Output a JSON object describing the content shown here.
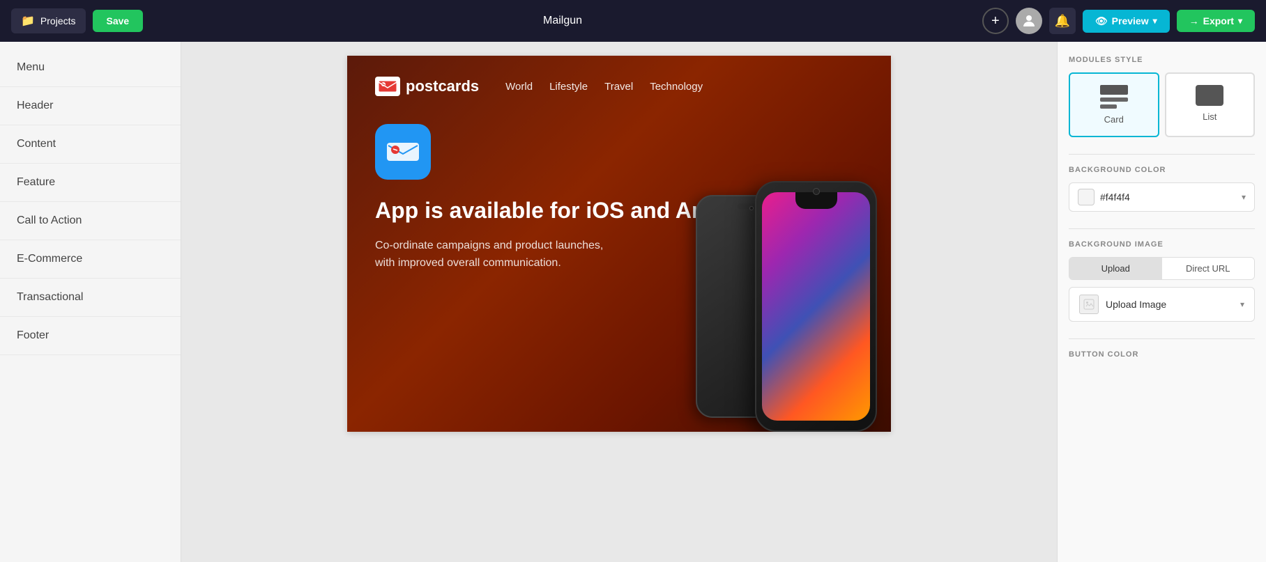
{
  "topbar": {
    "projects_label": "Projects",
    "save_label": "Save",
    "app_name": "Mailgun",
    "preview_label": "Preview",
    "export_label": "Export"
  },
  "left_sidebar": {
    "items": [
      {
        "id": "menu",
        "label": "Menu"
      },
      {
        "id": "header",
        "label": "Header"
      },
      {
        "id": "content",
        "label": "Content"
      },
      {
        "id": "feature",
        "label": "Feature"
      },
      {
        "id": "call-to-action",
        "label": "Call to Action"
      },
      {
        "id": "e-commerce",
        "label": "E-Commerce"
      },
      {
        "id": "transactional",
        "label": "Transactional"
      },
      {
        "id": "footer",
        "label": "Footer"
      }
    ]
  },
  "email_preview": {
    "nav": {
      "logo_text": "postcards",
      "links": [
        "World",
        "Lifestyle",
        "Travel",
        "Technology"
      ]
    },
    "hero": {
      "title": "App is available for iOS and Android.",
      "description": "Co-ordinate campaigns and product launches, with improved overall communication."
    }
  },
  "right_panel": {
    "modules_style_title": "MODULES STYLE",
    "card_label": "Card",
    "list_label": "List",
    "bg_color_title": "BACKGROUND COLOR",
    "bg_color_value": "#f4f4f4",
    "bg_image_title": "BACKGROUND IMAGE",
    "upload_tab_label": "Upload",
    "direct_url_tab_label": "Direct URL",
    "upload_image_label": "Upload Image",
    "btn_color_title": "BUTTON COLOR"
  },
  "icons": {
    "folder": "📁",
    "plus": "+",
    "bell": "🔔",
    "eye": "👁",
    "arrow_right": "→",
    "chevron_down": "▾"
  }
}
